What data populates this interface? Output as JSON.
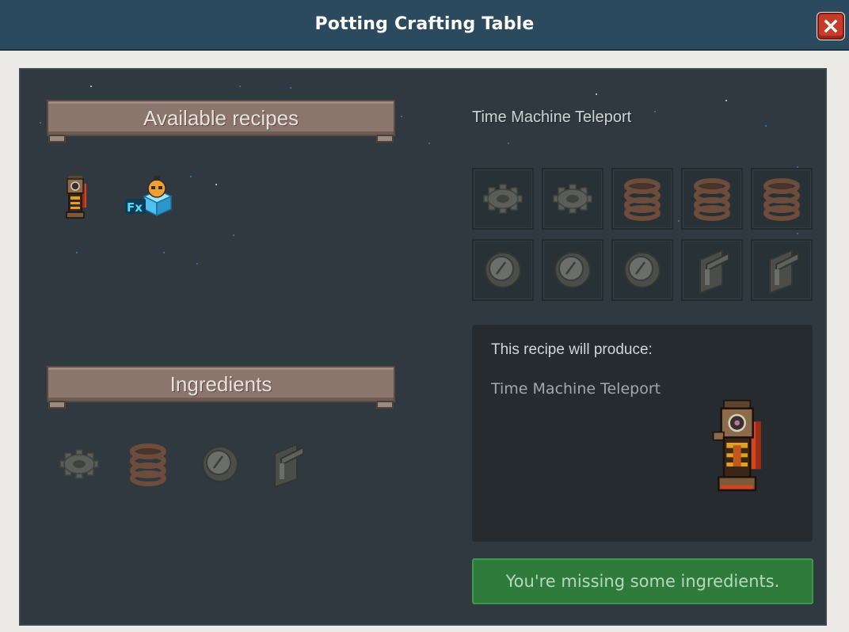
{
  "window": {
    "title": "Potting Crafting Table"
  },
  "recipes_panel": {
    "header": "Available recipes",
    "items": [
      {
        "name": "time-machine-teleport",
        "icon": "time-machine-icon"
      },
      {
        "name": "fx-effect",
        "icon": "fx-box-icon",
        "badge": "Fx"
      }
    ]
  },
  "ingredients_panel": {
    "header": "Ingredients",
    "items": [
      "gear-icon",
      "coil-icon",
      "dial-icon",
      "lever-icon"
    ]
  },
  "recipe_detail": {
    "name": "Time Machine Teleport",
    "grid": [
      "gear-icon",
      "gear-icon",
      "coil-icon",
      "coil-icon",
      "coil-icon",
      "dial-icon",
      "dial-icon",
      "dial-icon",
      "lever-icon",
      "lever-icon"
    ],
    "produce_heading": "This recipe will produce:",
    "produce_name": "Time Machine Teleport"
  },
  "status": {
    "message": "You're missing some ingredients."
  },
  "colors": {
    "titlebar": "#2c4a5e",
    "panel": "#2f393f",
    "banner": "#8b766d",
    "status": "#2e7b3c",
    "close": "#c73b2a"
  }
}
